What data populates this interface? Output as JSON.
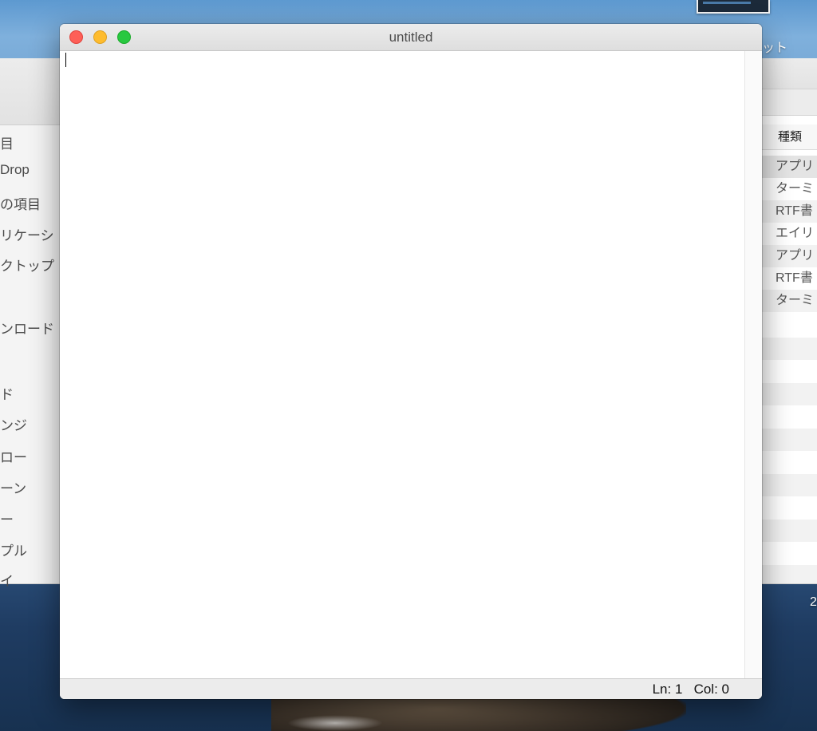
{
  "window": {
    "title": "untitled",
    "status": {
      "line_label": "Ln: 1",
      "col_label": "Col: 0"
    }
  },
  "background_finder": {
    "sidebar_items": [
      "目",
      "Drop",
      "の項目",
      "リケーシ",
      "クトップ",
      "ンロード",
      "ド",
      "ンジ",
      "ロー",
      "ーン",
      "ー",
      "プル",
      "イ"
    ],
    "column_header": "種類",
    "kind_rows": [
      "アプリ",
      "ターミ",
      "RTF書",
      "エイリ",
      "アプリ",
      "RTF書",
      "ターミ"
    ]
  },
  "desktop": {
    "label": "ット",
    "right_digit": "2"
  },
  "icons": {
    "close": "close-icon",
    "minimize": "minimize-icon",
    "zoom": "zoom-icon"
  },
  "colors": {
    "close": "#fe5f57",
    "minimize": "#febc2e",
    "zoom": "#28c840"
  }
}
